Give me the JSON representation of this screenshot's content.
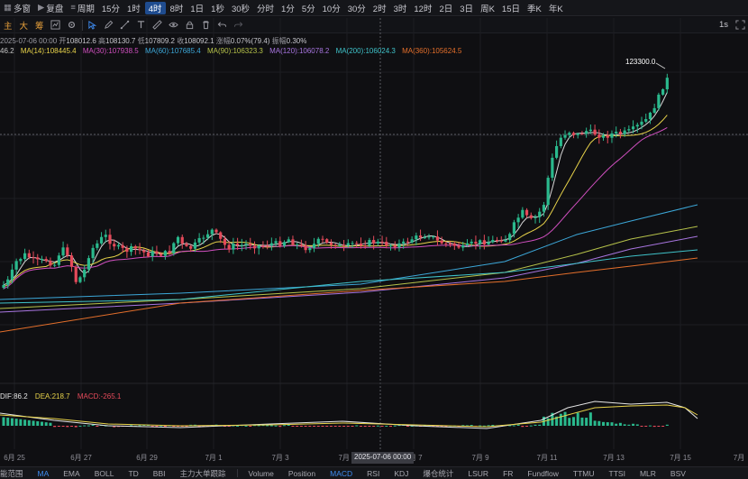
{
  "toolbar": {
    "multi_window": "多窗",
    "replay": "复盘",
    "period_menu": "周期",
    "intervals": [
      "15分",
      "1时",
      "4时",
      "8时",
      "1日",
      "1秒",
      "30秒",
      "分时",
      "1分",
      "5分",
      "10分",
      "30分",
      "2时",
      "3时",
      "12时",
      "2日",
      "3日",
      "周K",
      "15日",
      "季K",
      "年K"
    ],
    "active_interval": "4时",
    "indicator_buttons": [
      "主",
      "大",
      "筹"
    ],
    "right_value": "1s"
  },
  "ohlc": {
    "datetime": "2025-07-06 00:00",
    "open_label": "开",
    "open": "108012.6",
    "high_label": "高",
    "high": "108130.7",
    "low_label": "低",
    "low": "107809.2",
    "close_label": "收",
    "close": "108092.1",
    "change_label": "涨幅",
    "change": "0.07%(79.4)",
    "amplitude_label": "振幅",
    "amplitude": "0.30%"
  },
  "ma_legend": [
    {
      "text": "46.2",
      "color": "#c8c8c8"
    },
    {
      "text": "MA(14):108445.4",
      "color": "#e8d34a"
    },
    {
      "text": "MA(30):107938.5",
      "color": "#d04fbf"
    },
    {
      "text": "MA(60):107685.4",
      "color": "#3ca7d8"
    },
    {
      "text": "MA(90):106323.3",
      "color": "#b6c24a"
    },
    {
      "text": "MA(120):106078.2",
      "color": "#a875e0"
    },
    {
      "text": "MA(200):106024.3",
      "color": "#3fc2c9"
    },
    {
      "text": "MA(360):105624.5",
      "color": "#e46f2b"
    }
  ],
  "price_annotation": "123300.0",
  "macd": {
    "dif_label": "DIF:86.2",
    "dea_label": "DEA:218.7",
    "macd_label": "MACD:-265.1",
    "dif_color": "#e6e6e6",
    "dea_color": "#e8d34a",
    "macd_color": "#e54a5a"
  },
  "x_axis": [
    {
      "label": "6月 25"
    },
    {
      "label": "6月 27"
    },
    {
      "label": "6月 29"
    },
    {
      "label": "7月 1"
    },
    {
      "label": "7月 3"
    },
    {
      "label": "7月 5"
    },
    {
      "label": "7月 7"
    },
    {
      "label": "7月 9"
    },
    {
      "label": "7月 11"
    },
    {
      "label": "7月 13"
    },
    {
      "label": "7月 15"
    },
    {
      "label": "7月"
    }
  ],
  "crosshair_time": "2025-07-06 00:00",
  "bottom_tabs": [
    "能范围",
    "MA",
    "EMA",
    "BOLL",
    "TD",
    "BBI",
    "主力大单跟踪",
    "Volume",
    "Position",
    "MACD",
    "RSI",
    "KDJ",
    "爆仓统计",
    "LSUR",
    "FR",
    "Fundflow",
    "TTMU",
    "TTSI",
    "MLR",
    "BSV"
  ],
  "bottom_active": [
    "MA",
    "MACD"
  ],
  "colors": {
    "up": "#2ab98d",
    "down": "#e54a5a",
    "accent": "#3e8bf0"
  }
}
